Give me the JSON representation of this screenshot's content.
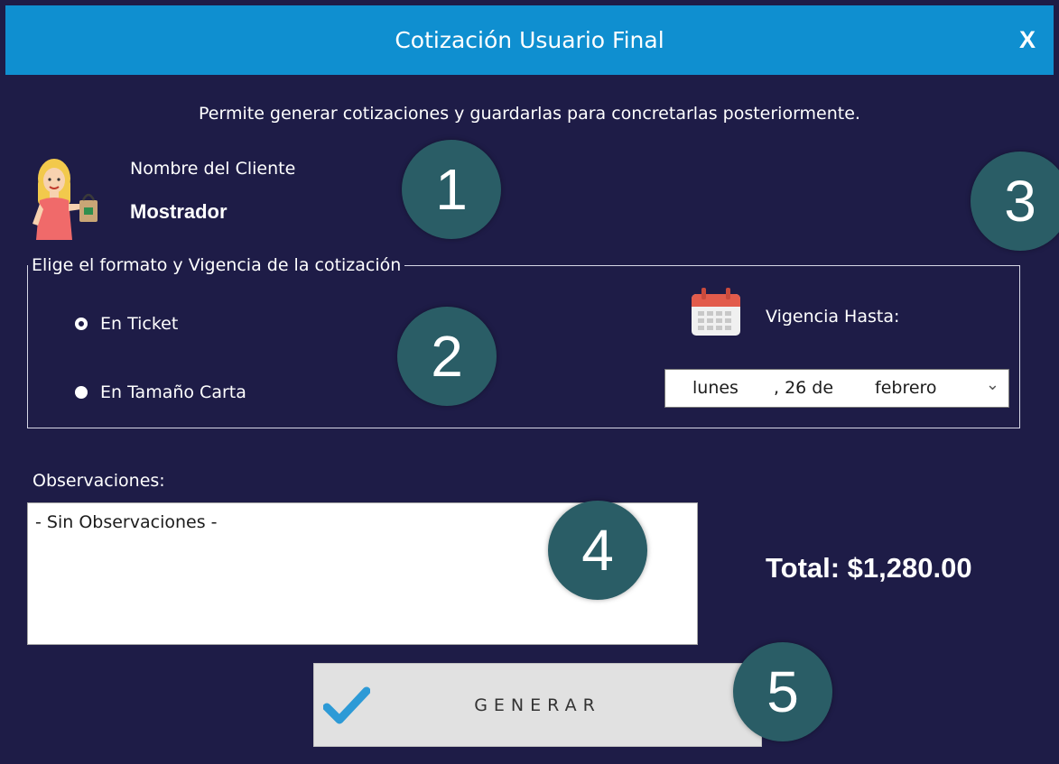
{
  "window": {
    "title": "Cotización Usuario Final",
    "close_label": "X"
  },
  "description": "Permite generar cotizaciones y guardarlas para concretarlas posteriormente.",
  "client": {
    "label": "Nombre del Cliente",
    "value": "Mostrador",
    "icon": "customer-shopping-icon"
  },
  "format_group": {
    "legend": "Elige el formato y Vigencia de la cotización",
    "options": [
      {
        "label": "En Ticket",
        "checked": true
      },
      {
        "label": "En Tamaño Carta",
        "checked": false
      }
    ],
    "validity": {
      "icon": "calendar-icon",
      "label": "Vigencia Hasta:",
      "weekday": "lunes",
      "day": ", 26 de",
      "month": "febrero"
    }
  },
  "observations": {
    "label": "Observaciones:",
    "value": "- Sin Observaciones -"
  },
  "total": "Total: $1,280.00",
  "generate_button": {
    "label": "GENERAR",
    "icon": "checkmark-icon"
  },
  "badges": [
    "1",
    "2",
    "3",
    "4",
    "5"
  ],
  "colors": {
    "background": "#1e1c47",
    "titlebar": "#0f8fd0",
    "badge": "#2a5d66",
    "button": "#e1e1e1"
  }
}
